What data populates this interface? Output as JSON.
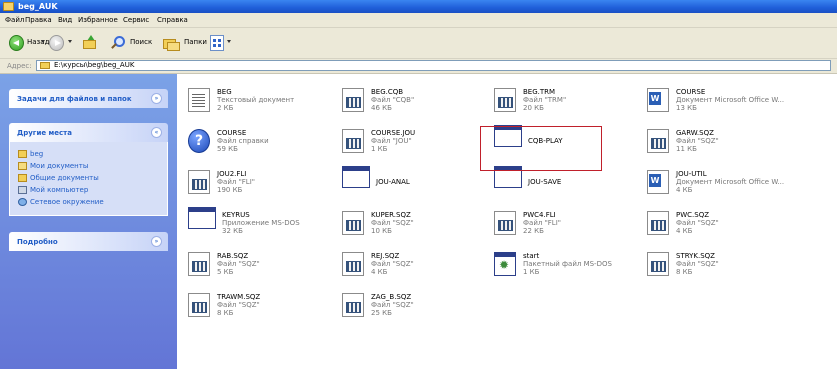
{
  "window": {
    "title": "beg_AUK"
  },
  "menu": [
    "Файл",
    "Правка",
    "Вид",
    "Избранное",
    "Сервис",
    "Справка"
  ],
  "toolbar": {
    "back_label": "Назад",
    "search_label": "Поиск",
    "folders_label": "Папки"
  },
  "address": {
    "label": "Адрес:",
    "value": "E:\\курсы\\beg\\beg_AUK"
  },
  "sidebar": {
    "tasks_title": "Задачи для файлов и папок",
    "places_title": "Другие места",
    "places": [
      "beg",
      "Мои документы",
      "Общие документы",
      "Мой компьютер",
      "Сетевое окружение"
    ],
    "details_title": "Подробно"
  },
  "files": [
    {
      "name": "BEG",
      "type": "Текстовый документ",
      "size": "2 КБ",
      "icon": "text-document-icon"
    },
    {
      "name": "BEG.CQB",
      "type": "Файл \"CQB\"",
      "size": "46 КБ",
      "icon": "generic-file-icon"
    },
    {
      "name": "BEG.TRM",
      "type": "Файл \"TRM\"",
      "size": "20 КБ",
      "icon": "generic-file-icon"
    },
    {
      "name": "COURSE",
      "type": "Документ Microsoft Office W...",
      "size": "13 КБ",
      "icon": "word-document-icon"
    },
    {
      "name": "COURSE",
      "type": "Файл справки",
      "size": "59 КБ",
      "icon": "help-file-icon"
    },
    {
      "name": "COURSE.JOU",
      "type": "Файл \"JOU\"",
      "size": "1 КБ",
      "icon": "generic-file-icon"
    },
    {
      "name": "CQB-PLAY",
      "type": "",
      "size": "",
      "icon": "application-window-icon"
    },
    {
      "name": "GARW.SQZ",
      "type": "Файл \"SQZ\"",
      "size": "11 КБ",
      "icon": "generic-file-icon"
    },
    {
      "name": "JOU2.FLI",
      "type": "Файл \"FLI\"",
      "size": "190 КБ",
      "icon": "generic-file-icon"
    },
    {
      "name": "JOU-ANAL",
      "type": "",
      "size": "",
      "icon": "application-window-icon"
    },
    {
      "name": "JOU-SAVE",
      "type": "",
      "size": "",
      "icon": "application-window-icon"
    },
    {
      "name": "JOU-UTIL",
      "type": "Документ Microsoft Office W...",
      "size": "4 КБ",
      "icon": "word-document-icon"
    },
    {
      "name": "KEYRUS",
      "type": "Приложение MS-DOS",
      "size": "32 КБ",
      "icon": "msdos-application-icon"
    },
    {
      "name": "KUPER.SQZ",
      "type": "Файл \"SQZ\"",
      "size": "10 КБ",
      "icon": "generic-file-icon"
    },
    {
      "name": "PWC4.FLI",
      "type": "Файл \"FLI\"",
      "size": "22 КБ",
      "icon": "generic-file-icon"
    },
    {
      "name": "PWC.SQZ",
      "type": "Файл \"SQZ\"",
      "size": "4 КБ",
      "icon": "generic-file-icon"
    },
    {
      "name": "RAB.SQZ",
      "type": "Файл \"SQZ\"",
      "size": "5 КБ",
      "icon": "generic-file-icon"
    },
    {
      "name": "REJ.SQZ",
      "type": "Файл \"SQZ\"",
      "size": "4 КБ",
      "icon": "generic-file-icon"
    },
    {
      "name": "start",
      "type": "Пакетный файл MS-DOS",
      "size": "1 КБ",
      "icon": "batch-file-icon"
    },
    {
      "name": "STRYK.SQZ",
      "type": "Файл \"SQZ\"",
      "size": "8 КБ",
      "icon": "generic-file-icon"
    },
    {
      "name": "TRAWM.SQZ",
      "type": "Файл \"SQZ\"",
      "size": "8 КБ",
      "icon": "generic-file-icon"
    },
    {
      "name": "ZAG_B.SQZ",
      "type": "Файл \"SQZ\"",
      "size": "25 КБ",
      "icon": "generic-file-icon"
    }
  ],
  "highlight_color": "#c0202b"
}
